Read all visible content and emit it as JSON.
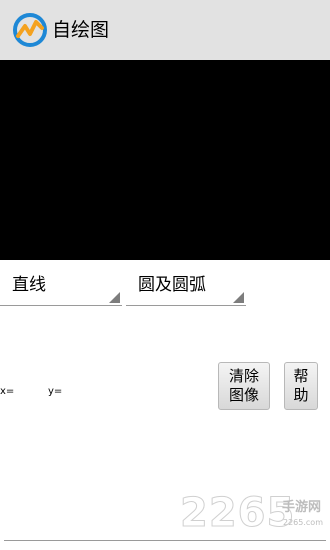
{
  "app": {
    "title": "自绘图",
    "logo_icon": "app-logo-icon"
  },
  "controls": {
    "shape_spinner": {
      "selected": "直线"
    },
    "curve_spinner": {
      "selected": "圆及圆弧"
    },
    "coords": {
      "x_label": "x=",
      "y_label": "y="
    },
    "clear_button": "清除\n图像",
    "help_button": "帮\n助"
  },
  "watermark": {
    "brand": "2265",
    "tag": "手游网",
    "url": "2265.com"
  },
  "colors": {
    "titlebar": "#e2e2e2",
    "canvas": "#000000",
    "logo_blue": "#1e88d6",
    "logo_orange": "#f4a21f"
  }
}
